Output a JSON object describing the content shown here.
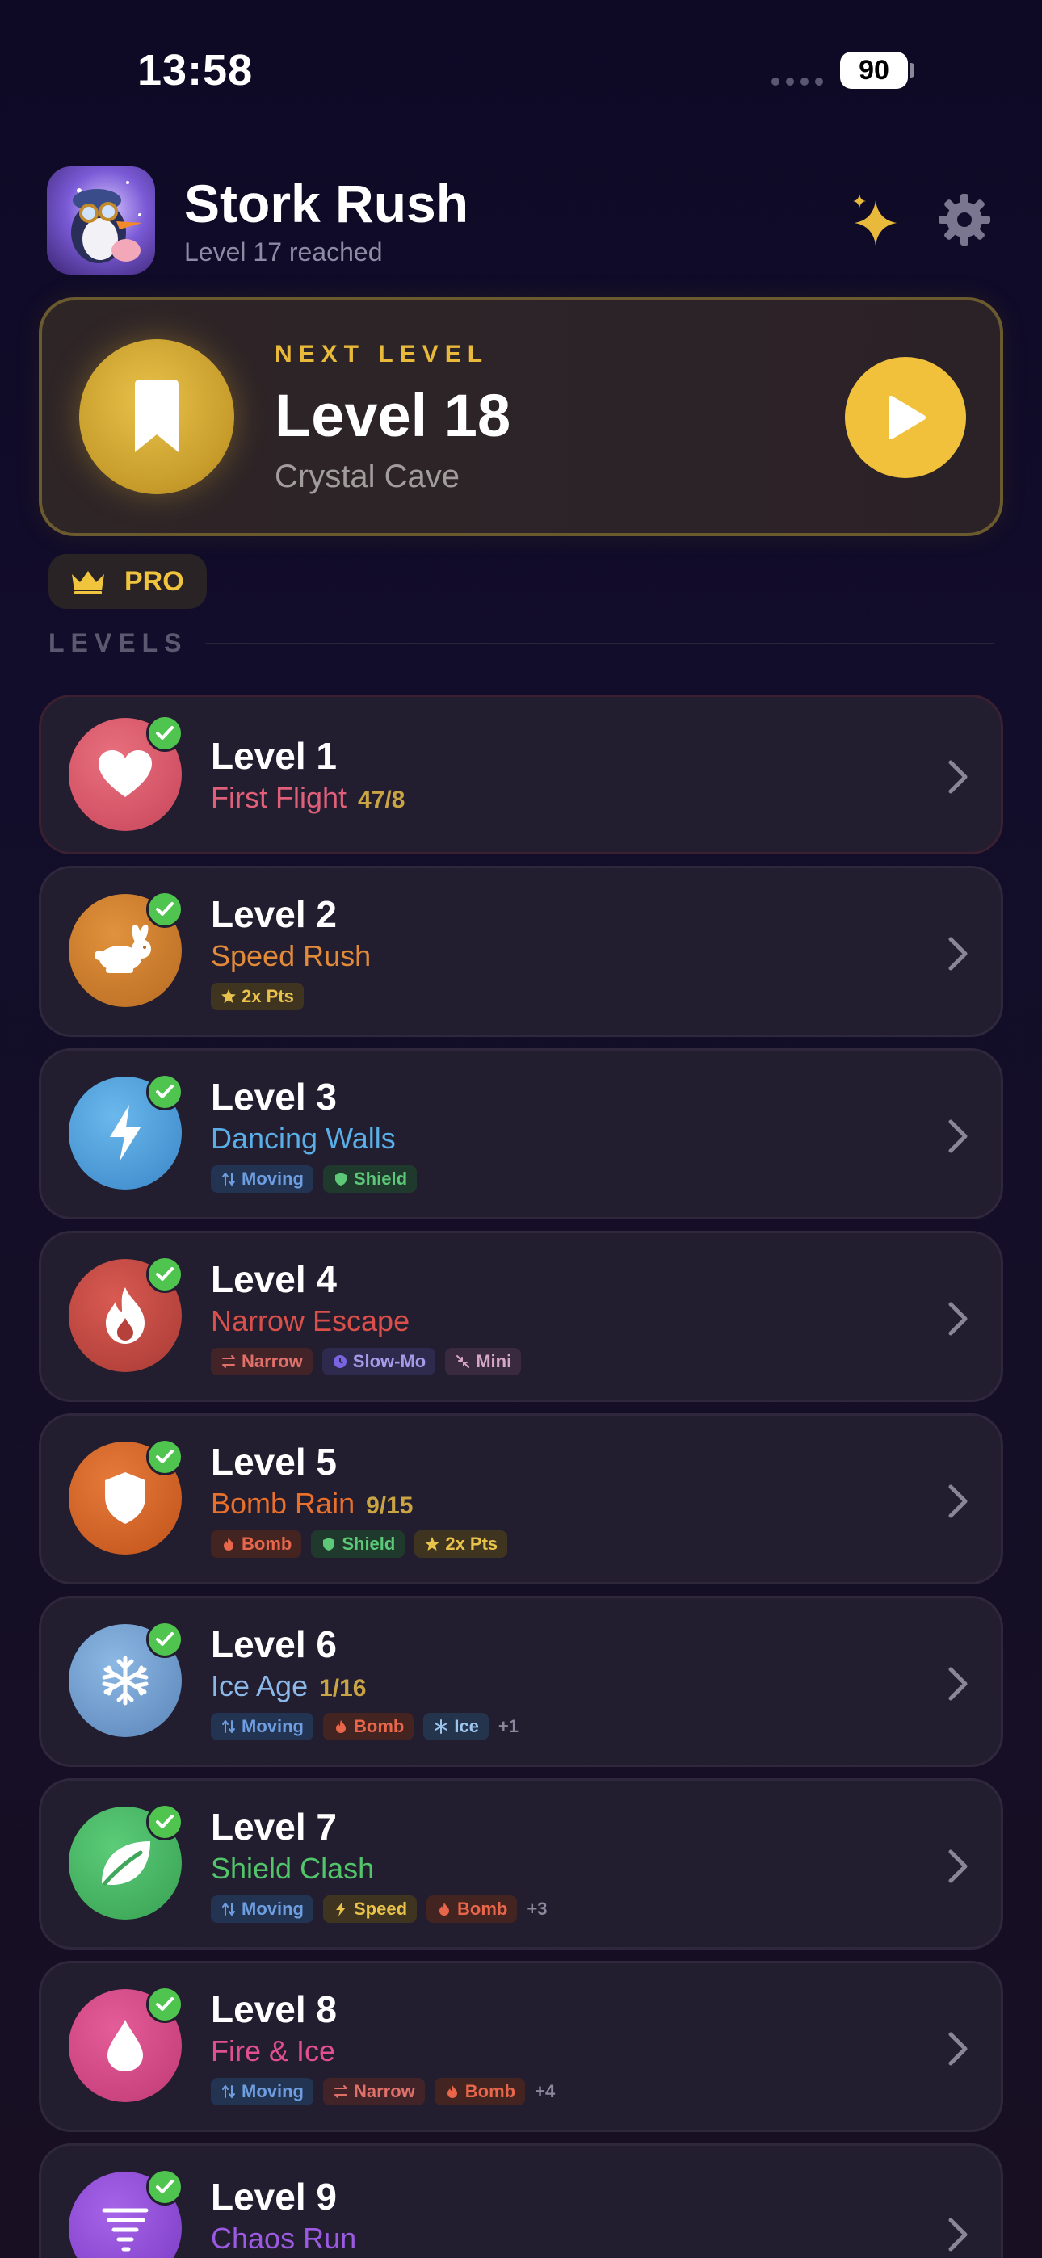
{
  "status": {
    "time": "13:58",
    "battery": "90"
  },
  "header": {
    "title": "Stork Rush",
    "subtitle": "Level 17 reached"
  },
  "next": {
    "label": "NEXT LEVEL",
    "title": "Level 18",
    "subtitle": "Crystal Cave"
  },
  "pro": {
    "label": "PRO"
  },
  "section": {
    "label": "LEVELS"
  },
  "levels": [
    {
      "title": "Level 1",
      "name": "First Flight",
      "count": "47/8",
      "color": "#e0607a",
      "icon": "heart-icon",
      "tags": []
    },
    {
      "title": "Level 2",
      "name": "Speed Rush",
      "count": "",
      "color": "#e08a3a",
      "icon": "rabbit-icon",
      "tags": [
        {
          "label": "2x Pts",
          "kind": "points"
        }
      ]
    },
    {
      "title": "Level 3",
      "name": "Dancing Walls",
      "count": "",
      "color": "#5aaee8",
      "icon": "bolt-icon",
      "tags": [
        {
          "label": "Moving",
          "kind": "moving"
        },
        {
          "label": "Shield",
          "kind": "shield"
        }
      ]
    },
    {
      "title": "Level 4",
      "name": "Narrow Escape",
      "count": "",
      "color": "#d9504a",
      "icon": "flame-icon",
      "tags": [
        {
          "label": "Narrow",
          "kind": "narrow"
        },
        {
          "label": "Slow-Mo",
          "kind": "slowmo"
        },
        {
          "label": "Mini",
          "kind": "mini"
        }
      ]
    },
    {
      "title": "Level 5",
      "name": "Bomb Rain",
      "count": "9/15",
      "color": "#e8702a",
      "icon": "shield-icon",
      "tags": [
        {
          "label": "Bomb",
          "kind": "bomb"
        },
        {
          "label": "Shield",
          "kind": "shield"
        },
        {
          "label": "2x Pts",
          "kind": "points"
        }
      ]
    },
    {
      "title": "Level 6",
      "name": "Ice Age",
      "count": "1/16",
      "color": "#8ab8e8",
      "icon": "snowflake-icon",
      "tags": [
        {
          "label": "Moving",
          "kind": "moving"
        },
        {
          "label": "Bomb",
          "kind": "bomb"
        },
        {
          "label": "Ice",
          "kind": "ice"
        }
      ],
      "more": "+1"
    },
    {
      "title": "Level 7",
      "name": "Shield Clash",
      "count": "",
      "color": "#52c46a",
      "icon": "leaf-icon",
      "tags": [
        {
          "label": "Moving",
          "kind": "moving"
        },
        {
          "label": "Speed",
          "kind": "speed"
        },
        {
          "label": "Bomb",
          "kind": "bomb"
        }
      ],
      "more": "+3"
    },
    {
      "title": "Level 8",
      "name": "Fire & Ice",
      "count": "",
      "color": "#e0508e",
      "icon": "drop-icon",
      "tags": [
        {
          "label": "Moving",
          "kind": "moving"
        },
        {
          "label": "Narrow",
          "kind": "narrow"
        },
        {
          "label": "Bomb",
          "kind": "bomb"
        }
      ],
      "more": "+4"
    },
    {
      "title": "Level 9",
      "name": "Chaos Run",
      "count": "",
      "color": "#9b5ae0",
      "icon": "tornado-icon",
      "tags": []
    }
  ]
}
